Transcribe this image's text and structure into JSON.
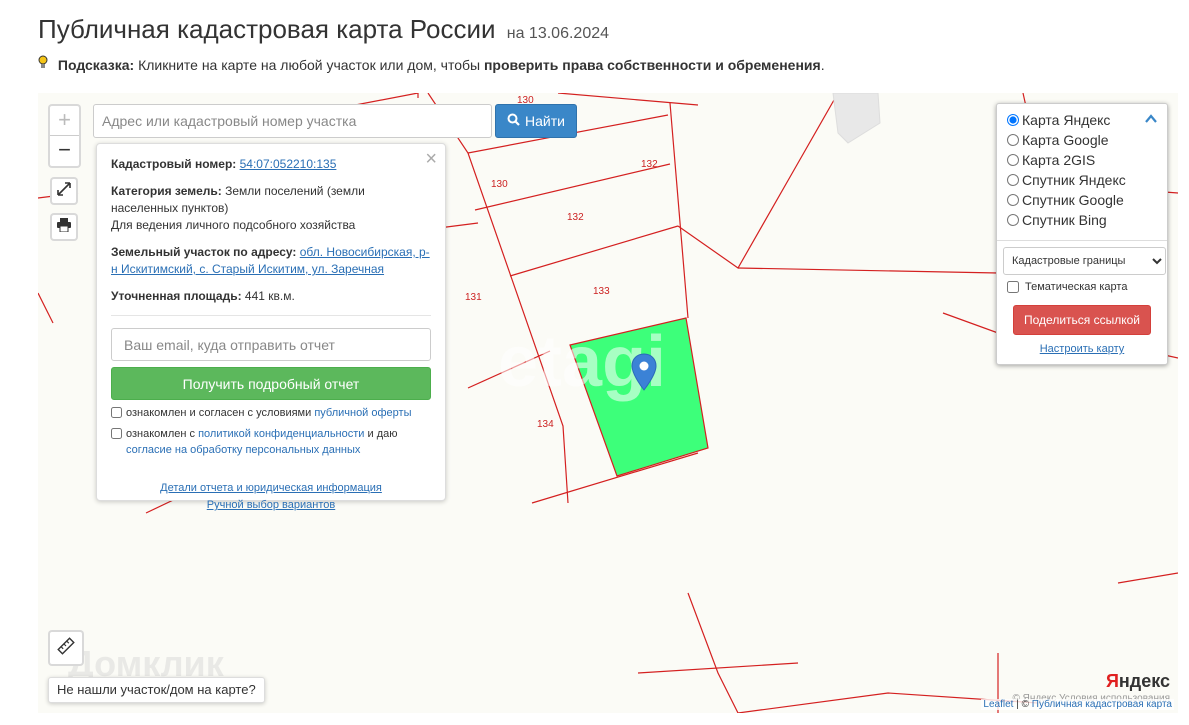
{
  "header": {
    "title": "Публичная кадастровая карта России",
    "date": "на 13.06.2024"
  },
  "hint": {
    "label": "Подсказка:",
    "text": " Кликните на карте на любой участок или дом, чтобы ",
    "bold_text": "проверить права собственности и обременения",
    "end": "."
  },
  "search": {
    "placeholder": "Адрес или кадастровый номер участка",
    "button_label": "Найти"
  },
  "zoom": {
    "plus": "+",
    "minus": "−"
  },
  "info": {
    "close": "×",
    "cadastral_label": "Кадастровый номер:",
    "cadastral_number": "54:07:052210:135",
    "category_label": "Категория земель:",
    "category_value": " Земли поселений (земли населенных пунктов)",
    "usage": "Для ведения личного подсобного хозяйства",
    "address_label": "Земельный участок по адресу:",
    "address_value": "обл. Новосибирская, р-н Искитимский, с. Старый Искитим, ул. Заречная",
    "area_label": "Уточненная площадь:",
    "area_value": " 441 кв.м.",
    "email_placeholder": "Ваш email, куда отправить отчет",
    "report_button": "Получить подробный отчет",
    "consent1_text": "ознакомлен и согласен с условиями ",
    "consent1_link": "публичной оферты",
    "consent2_text": "ознакомлен с ",
    "consent2_link": "политикой конфиденциальности",
    "consent2_mid": " и даю ",
    "consent2_link2": "согласие на обработку персональных данных",
    "details_link": "Детали отчета и юридическая информация",
    "manual_link": "Ручной выбор вариантов"
  },
  "layers": {
    "options": [
      "Карта Яндекс",
      "Карта Google",
      "Карта 2GIS",
      "Спутник Яндекс",
      "Спутник Google",
      "Спутник Bing"
    ],
    "selected": "Карта Яндекс",
    "select_value": "Кадастровые границы",
    "theme_label": "Тематическая карта",
    "share_button": "Поделиться ссылкой",
    "config_link": "Настроить карту"
  },
  "map": {
    "parcels": [
      "130",
      "130",
      "132",
      "132",
      "131",
      "133",
      "134"
    ],
    "watermark": "etagi",
    "watermark2": "Домклик",
    "not_found": "Не нашли участок/дом на карте?",
    "yandex_logo_y": "Я",
    "yandex_logo_rest": "ндекс",
    "terms": "© Яндекс  Условия использования",
    "attribution_leaflet": "Leaflet",
    "attribution_sep": " | © ",
    "attribution_pkk": "Публичная кадастровая карта"
  },
  "colors": {
    "parcel_border": "#d42020",
    "selected_parcel": "#3dff7a",
    "search_button": "#3a87c8",
    "report_button": "#5cb85c",
    "share_button": "#d9534f",
    "marker": "#3b82d6"
  },
  "icons": [
    "search-icon",
    "fullscreen-icon",
    "print-icon",
    "ruler-icon",
    "map-marker-icon",
    "chevron-up-icon",
    "lightbulb-icon"
  ]
}
